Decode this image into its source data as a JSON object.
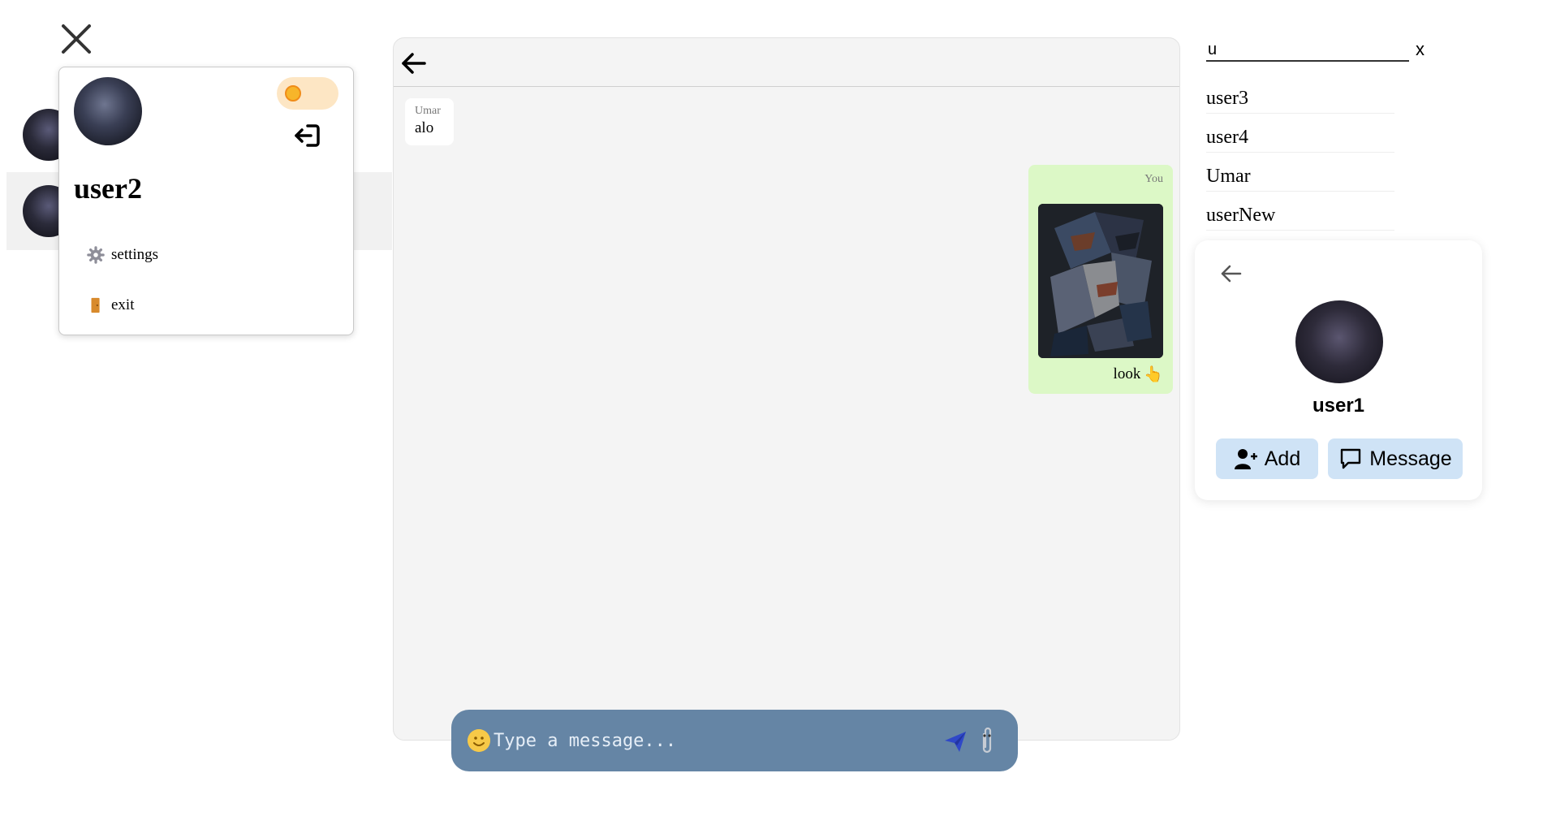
{
  "profile": {
    "username": "user2",
    "menu": [
      {
        "id": "settings",
        "label": "settings",
        "icon": "gear-icon"
      },
      {
        "id": "exit",
        "label": "exit",
        "icon": "door-icon"
      }
    ],
    "icons": [
      "close-icon",
      "sun-icon",
      "logout-icon"
    ]
  },
  "chat": {
    "messages": [
      {
        "direction": "incoming",
        "sender": "Umar",
        "text": "alo"
      },
      {
        "direction": "outgoing",
        "sender": "You",
        "text": "look",
        "emoji": "👆"
      }
    ],
    "composer": {
      "placeholder": "Type a message...",
      "icons": [
        "smile-icon",
        "send-icon",
        "paperclip-icon"
      ]
    }
  },
  "search": {
    "value": "u",
    "clear_label": "x",
    "results": [
      "user3",
      "user4",
      "Umar",
      "userNew"
    ]
  },
  "user_card": {
    "username": "user1",
    "add_label": "Add",
    "message_label": "Message"
  },
  "colors": {
    "composer_bg": "#6585a5",
    "outgoing_bubble": "#dcf8c6",
    "card_button": "#cfe3f6",
    "theme_toggle": "#fde6c4"
  }
}
